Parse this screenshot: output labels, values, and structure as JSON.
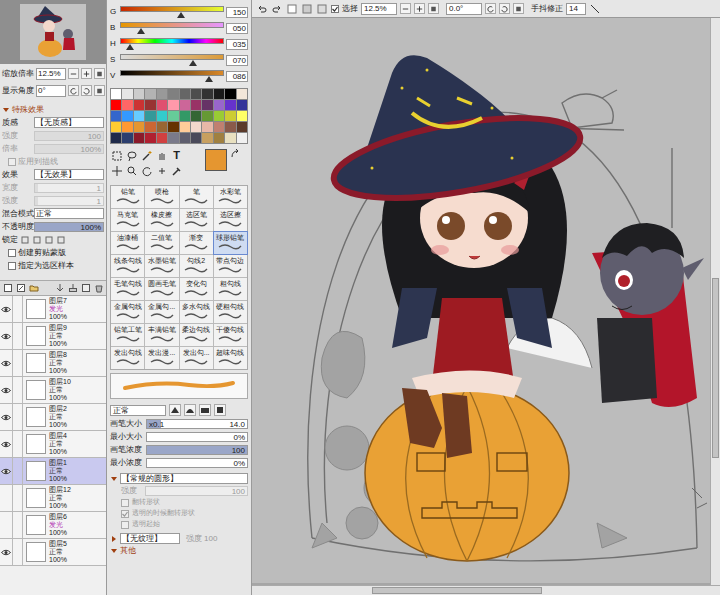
{
  "left": {
    "zoom": {
      "label": "缩放倍率",
      "value": "12.5%"
    },
    "angle": {
      "label": "显示角度",
      "value": "0°"
    },
    "section": {
      "label": "特殊效果",
      "expanded": true
    },
    "props": [
      {
        "kind": "select",
        "label": "质感",
        "value": "【无质感】",
        "disabled": false
      },
      {
        "kind": "slider",
        "label": "强度",
        "value": "100",
        "disabled": true,
        "level": 1
      },
      {
        "kind": "slider",
        "label": "倍率",
        "value": "100%",
        "disabled": true,
        "level": 1
      },
      {
        "kind": "check",
        "label": "应用到描线",
        "checked": false,
        "disabled": true
      },
      {
        "kind": "select",
        "label": "效果",
        "value": "【无效果】",
        "disabled": false
      },
      {
        "kind": "slider",
        "label": "宽度",
        "value": "1",
        "disabled": true,
        "level": 0.05
      },
      {
        "kind": "slider",
        "label": "强度",
        "value": "1",
        "disabled": true,
        "level": 0.05
      },
      {
        "kind": "select",
        "label": "混合模式",
        "value": "正常",
        "disabled": false
      },
      {
        "kind": "slider",
        "label": "不透明度",
        "value": "100%",
        "disabled": false,
        "level": 1
      },
      {
        "kind": "lock",
        "label": "锁定",
        "disabled": false
      },
      {
        "kind": "check",
        "label": "创建剪贴蒙版",
        "checked": false,
        "disabled": false
      },
      {
        "kind": "check",
        "label": "指定为选区样本",
        "checked": false,
        "disabled": false
      }
    ],
    "layers": [
      {
        "name": "图层7",
        "mode": "发光",
        "opacity": "100%",
        "visible": true,
        "selected": false,
        "color": "#b02cb0"
      },
      {
        "name": "图层9",
        "mode": "正常",
        "opacity": "100%",
        "visible": true,
        "selected": false,
        "color": "#333333"
      },
      {
        "name": "图层8",
        "mode": "正常",
        "opacity": "100%",
        "visible": true,
        "selected": false,
        "color": "#333333"
      },
      {
        "name": "图层10",
        "mode": "正常",
        "opacity": "100%",
        "visible": true,
        "selected": false,
        "color": "#333333"
      },
      {
        "name": "图层2",
        "mode": "正常",
        "opacity": "100%",
        "visible": true,
        "selected": false,
        "color": "#333333"
      },
      {
        "name": "图层4",
        "mode": "正常",
        "opacity": "100%",
        "visible": true,
        "selected": false,
        "color": "#333333"
      },
      {
        "name": "图层1",
        "mode": "正常",
        "opacity": "100%",
        "visible": true,
        "selected": true,
        "color": "#333333"
      },
      {
        "name": "图层12",
        "mode": "正常",
        "opacity": "100%",
        "visible": false,
        "selected": false,
        "color": "#333333"
      },
      {
        "name": "图层6",
        "mode": "发光",
        "opacity": "100%",
        "visible": false,
        "selected": false,
        "color": "#b02cb0"
      },
      {
        "name": "图层5",
        "mode": "正常",
        "opacity": "100%",
        "visible": true,
        "selected": false,
        "color": "#333333"
      }
    ]
  },
  "color": {
    "sliders": [
      {
        "label": "G",
        "value": "150",
        "level": 0.59
      },
      {
        "label": "B",
        "value": "050",
        "level": 0.2
      },
      {
        "label": "H",
        "value": "035",
        "level": 0.1
      },
      {
        "label": "S",
        "value": "070",
        "level": 0.7
      },
      {
        "label": "V",
        "value": "086",
        "level": 0.86
      }
    ],
    "swatches": [
      "#ffffff",
      "#e6e6e6",
      "#cccccc",
      "#b3b3b3",
      "#999999",
      "#808080",
      "#666666",
      "#4d4d4d",
      "#333333",
      "#1a1a1a",
      "#000000",
      "#f2e6d9",
      "#ff0000",
      "#ff6666",
      "#cc3333",
      "#993333",
      "#e05070",
      "#ff99aa",
      "#cc6699",
      "#993366",
      "#663366",
      "#9966cc",
      "#6633cc",
      "#333399",
      "#3366cc",
      "#3399ff",
      "#66ccff",
      "#339999",
      "#33cccc",
      "#66cc99",
      "#339966",
      "#336633",
      "#669933",
      "#99cc33",
      "#cccc33",
      "#ffff66",
      "#ffcc33",
      "#ff9933",
      "#e59630",
      "#cc6633",
      "#996633",
      "#663300",
      "#ffcc99",
      "#f3d8cc",
      "#e8b8a8",
      "#c08070",
      "#8a5a4a",
      "#5a3a2a",
      "#1f2a4a",
      "#2c3e6e",
      "#8b1a2a",
      "#b02030",
      "#d04040",
      "#7a7a8a",
      "#5e5e6e",
      "#4a4a5a",
      "#c8a060",
      "#a08040",
      "#e8e0c0",
      "#f0f0f0"
    ],
    "current": "#e59630",
    "text_tool": "T"
  },
  "brushes": [
    {
      "name": "铅笔",
      "selected": false
    },
    {
      "name": "喷枪",
      "selected": false
    },
    {
      "name": "笔",
      "selected": false
    },
    {
      "name": "水彩笔",
      "selected": false
    },
    {
      "name": "马克笔",
      "selected": false
    },
    {
      "name": "橡皮擦",
      "selected": false
    },
    {
      "name": "选区笔",
      "selected": false
    },
    {
      "name": "选区擦",
      "selected": false
    },
    {
      "name": "油漆桶",
      "selected": false
    },
    {
      "name": "二值笔",
      "selected": false
    },
    {
      "name": "渐变",
      "selected": false
    },
    {
      "name": "球形铅笔",
      "selected": true
    },
    {
      "name": "线条勾线",
      "selected": false
    },
    {
      "name": "水墨铅笔",
      "selected": false
    },
    {
      "name": "勾线2",
      "selected": false
    },
    {
      "name": "带点勾边",
      "selected": false
    },
    {
      "name": "毛笔勾线",
      "selected": false
    },
    {
      "name": "圆画毛笔",
      "selected": false
    },
    {
      "name": "变化勾",
      "selected": false
    },
    {
      "name": "粗勾线",
      "selected": false
    },
    {
      "name": "金属勾线",
      "selected": false
    },
    {
      "name": "金属勾...",
      "selected": false
    },
    {
      "name": "多水勾线",
      "selected": false
    },
    {
      "name": "硬粗勾线",
      "selected": false
    },
    {
      "name": "铅笔工笔",
      "selected": false
    },
    {
      "name": "丰满铅笔",
      "selected": false
    },
    {
      "name": "柔边勾线",
      "selected": false
    },
    {
      "name": "干傻勾线",
      "selected": false
    },
    {
      "name": "发出勾线",
      "selected": false
    },
    {
      "name": "发出漫...",
      "selected": false
    },
    {
      "name": "发出勾...",
      "selected": false
    },
    {
      "name": "超味勾线",
      "selected": false
    }
  ],
  "brush_settings": {
    "mode": "正常",
    "rows": [
      {
        "label": "画笔大小",
        "multiplier": "x0.1",
        "value": "14.0",
        "level": 0.14
      },
      {
        "label": "最小大小",
        "multiplier": "",
        "value": "0%",
        "level": 0
      },
      {
        "label": "画笔浓度",
        "multiplier": "",
        "value": "100",
        "level": 1
      },
      {
        "label": "最小浓度",
        "multiplier": "",
        "value": "0%",
        "level": 0
      }
    ],
    "shape": {
      "label": "【常规的圆形】",
      "expanded": true,
      "strength_label": "强度",
      "strength": "100"
    },
    "options": [
      {
        "label": "翻转形状",
        "checked": false,
        "disabled": true
      },
      {
        "label": "透明的时候翻转形状",
        "checked": true,
        "disabled": true
      },
      {
        "label": "透明起始",
        "checked": false,
        "disabled": true
      }
    ],
    "texture": {
      "label": "【无纹理】",
      "expanded": false,
      "strength_label": "强度",
      "strength": "100"
    },
    "other": {
      "label": "其他",
      "expanded": true
    }
  },
  "toolbar": {
    "select_label": "选择",
    "select_checked": true,
    "zoom": "12.5%",
    "angle": "0.0°",
    "stabilizer_label": "手抖修正",
    "stabilizer": "14"
  }
}
